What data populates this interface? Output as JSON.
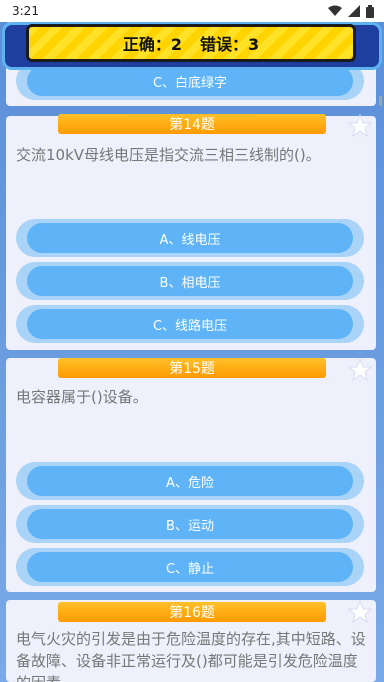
{
  "status_bar": {
    "time": "3:21"
  },
  "score": {
    "correct": "正确：2",
    "wrong": "错误：3"
  },
  "prev_option": "C、白底绿字",
  "questions": [
    {
      "header": "第14题",
      "text": "交流10kV母线电压是指交流三相三线制的()。",
      "options": [
        "A、线电压",
        "B、相电压",
        "C、线路电压"
      ]
    },
    {
      "header": "第15题",
      "text": "电容器属于()设备。",
      "options": [
        "A、危险",
        "B、运动",
        "C、静止"
      ]
    },
    {
      "header": "第16题",
      "text": "电气火灾的引发是由于危险温度的存在,其中短路、设备故障、设备非正常运行及()都可能是引发危险温度的因素。"
    }
  ]
}
